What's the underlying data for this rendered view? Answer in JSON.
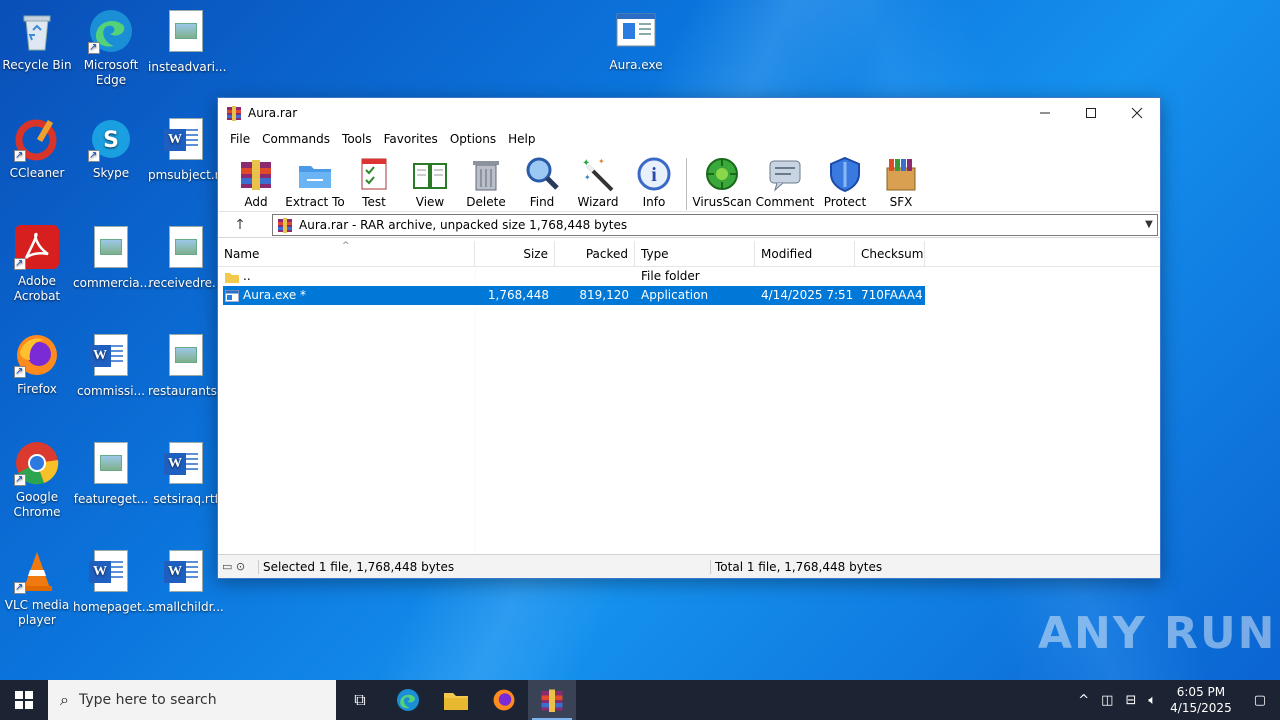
{
  "desktop": {
    "icons": [
      {
        "label": "Recycle Bin"
      },
      {
        "label": "Microsoft Edge"
      },
      {
        "label": "insteadvari..."
      },
      {
        "label": "CCleaner"
      },
      {
        "label": "Skype"
      },
      {
        "label": "pmsubject.r..."
      },
      {
        "label": "Adobe Acrobat"
      },
      {
        "label": "commercia..."
      },
      {
        "label": "receivedre..."
      },
      {
        "label": "Firefox"
      },
      {
        "label": "commissi..."
      },
      {
        "label": "restaurants..."
      },
      {
        "label": "Google Chrome"
      },
      {
        "label": "featureget..."
      },
      {
        "label": "setsiraq.rtf"
      },
      {
        "label": "VLC media player"
      },
      {
        "label": "homepaget..."
      },
      {
        "label": "smallchildr..."
      },
      {
        "label": "Aura.exe"
      }
    ],
    "watermark": "ANY RUN"
  },
  "window": {
    "title": "Aura.rar",
    "menu": [
      "File",
      "Commands",
      "Tools",
      "Favorites",
      "Options",
      "Help"
    ],
    "toolbar": [
      "Add",
      "Extract To",
      "Test",
      "View",
      "Delete",
      "Find",
      "Wizard",
      "Info",
      "VirusScan",
      "Comment",
      "Protect",
      "SFX"
    ],
    "path": "Aura.rar - RAR archive, unpacked size 1,768,448 bytes",
    "columns": [
      "Name",
      "Size",
      "Packed",
      "Type",
      "Modified",
      "Checksum"
    ],
    "rows": [
      {
        "name": "..",
        "size": "",
        "packed": "",
        "type": "File folder",
        "modified": "",
        "checksum": ""
      },
      {
        "name": "Aura.exe *",
        "size": "1,768,448",
        "packed": "819,120",
        "type": "Application",
        "modified": "4/14/2025 7:51 ...",
        "checksum": "710FAAA4"
      }
    ],
    "status_left": "Selected 1 file, 1,768,448 bytes",
    "status_right": "Total 1 file, 1,768,448 bytes"
  },
  "taskbar": {
    "search_placeholder": "Type here to search",
    "time": "6:05 PM",
    "date": "4/15/2025"
  }
}
